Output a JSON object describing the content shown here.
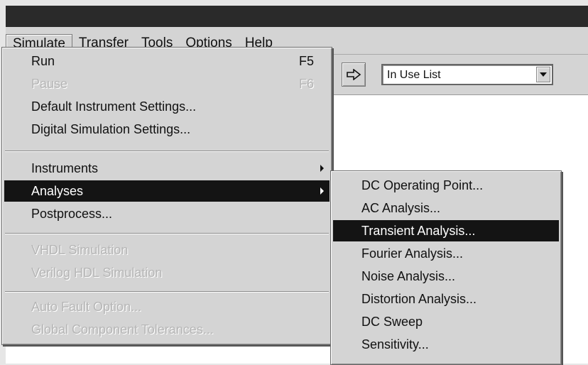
{
  "menubar": {
    "items": [
      {
        "label": "Simulate"
      },
      {
        "label": "Transfer"
      },
      {
        "label": "Tools"
      },
      {
        "label": "Options"
      },
      {
        "label": "Help"
      }
    ]
  },
  "toolbar": {
    "dropdown_value": "In Use List"
  },
  "simulate_menu": {
    "run": "Run",
    "run_shortcut": "F5",
    "pause": "Pause",
    "pause_shortcut": "F6",
    "default_instrument_settings": "Default Instrument Settings...",
    "digital_simulation_settings": "Digital Simulation Settings...",
    "instruments": "Instruments",
    "analyses": "Analyses",
    "postprocess": "Postprocess...",
    "vhdl_simulation": "VHDL Simulation",
    "verilog_hdl_simulation": "Verilog HDL Simulation",
    "auto_fault_option": "Auto Fault Option...",
    "global_component_tolerances": "Global Component Tolerances..."
  },
  "analyses_submenu": {
    "items": [
      "DC Operating Point...",
      "AC Analysis...",
      "Transient Analysis...",
      "Fourier Analysis...",
      "Noise Analysis...",
      "Distortion Analysis...",
      "DC Sweep",
      "Sensitivity..."
    ]
  }
}
